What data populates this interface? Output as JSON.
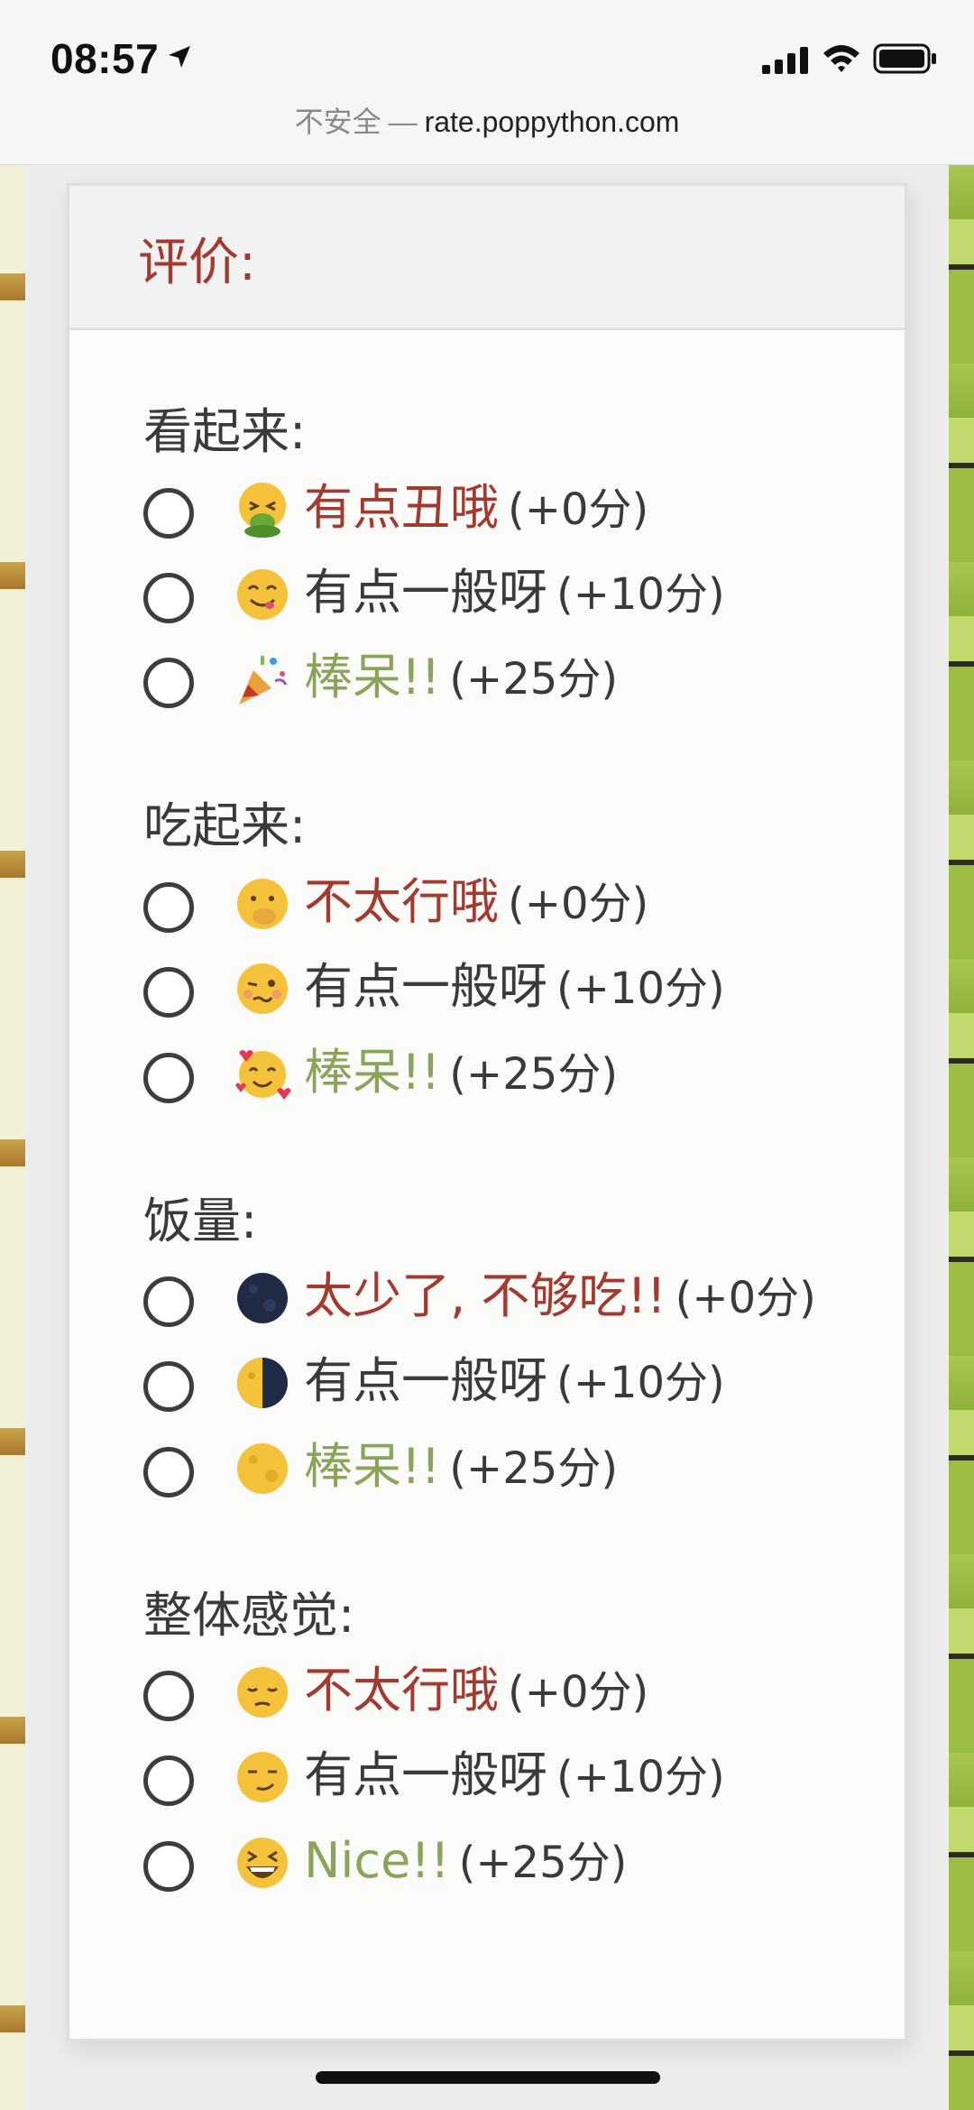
{
  "status_bar": {
    "time": "08:57"
  },
  "url_bar": {
    "insecure_label": "不安全",
    "separator": "—",
    "domain": "rate.poppython.com"
  },
  "card": {
    "title": "评价:"
  },
  "questions": [
    {
      "label": "看起来:",
      "options": [
        {
          "text": "有点丑哦",
          "points": "(+0分)",
          "tone": "bad",
          "emoji": "nauseated-face"
        },
        {
          "text": "有点一般呀",
          "points": "(+10分)",
          "tone": "mid",
          "emoji": "yum-face"
        },
        {
          "text": "棒呆!!",
          "points": "(+25分)",
          "tone": "good",
          "emoji": "party-popper"
        }
      ]
    },
    {
      "label": "吃起来:",
      "options": [
        {
          "text": "不太行哦",
          "points": "(+0分)",
          "tone": "bad",
          "emoji": "hand-over-mouth-face"
        },
        {
          "text": "有点一般呀",
          "points": "(+10分)",
          "tone": "mid",
          "emoji": "woozy-face"
        },
        {
          "text": "棒呆!!",
          "points": "(+25分)",
          "tone": "good",
          "emoji": "smiling-face-with-hearts"
        }
      ]
    },
    {
      "label": "饭量:",
      "options": [
        {
          "text": "太少了, 不够吃!!",
          "points": "(+0分)",
          "tone": "bad",
          "emoji": "new-moon"
        },
        {
          "text": "有点一般呀",
          "points": "(+10分)",
          "tone": "mid",
          "emoji": "half-moon"
        },
        {
          "text": "棒呆!!",
          "points": "(+25分)",
          "tone": "good",
          "emoji": "full-moon"
        }
      ]
    },
    {
      "label": "整体感觉:",
      "options": [
        {
          "text": "不太行哦",
          "points": "(+0分)",
          "tone": "bad",
          "emoji": "pensive-face"
        },
        {
          "text": "有点一般呀",
          "points": "(+10分)",
          "tone": "mid",
          "emoji": "smirk-face"
        },
        {
          "text": "Nice!!",
          "points": "(+25分)",
          "tone": "good",
          "emoji": "grinning-squint-face"
        }
      ]
    }
  ],
  "colors": {
    "bad": "#a33a2f",
    "mid": "#3a3a3a",
    "good": "#8aa55a"
  }
}
